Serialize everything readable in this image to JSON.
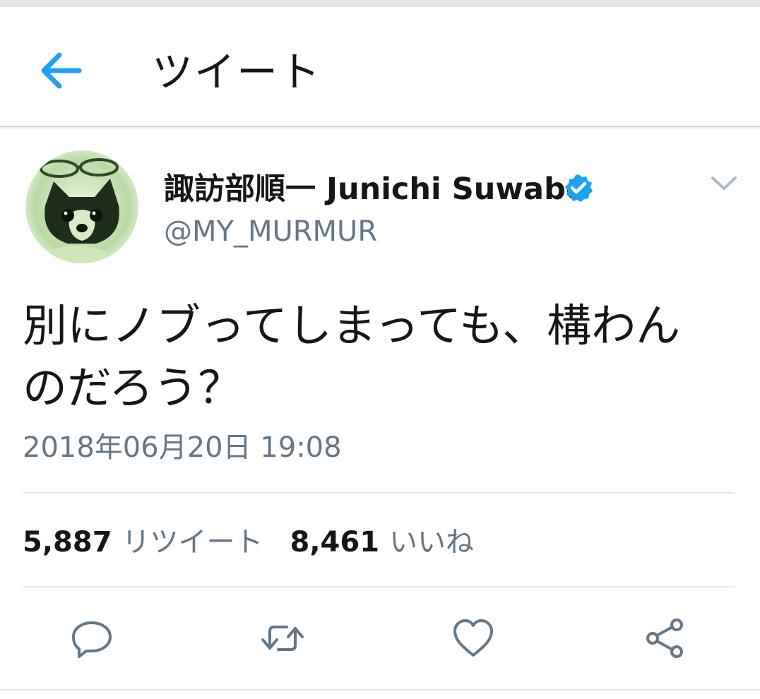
{
  "header": {
    "title": "ツイート",
    "back_icon": "arrow-left-icon",
    "accent_color": "#1da1f2"
  },
  "tweet": {
    "author": {
      "display_name": "諏訪部順一 Junichi Suwabe",
      "handle": "@MY_MURMUR",
      "verified_icon": "verified-badge-icon"
    },
    "menu_icon": "chevron-down-icon",
    "text": "別にノブってしまっても、構わん\nのだろう？",
    "timestamp": "2018年06月20日 19:08",
    "stats": {
      "retweet_count": "5,887",
      "retweet_label": "リツイート",
      "like_count": "8,461",
      "like_label": "いいね"
    },
    "actions": [
      "reply-icon",
      "retweet-icon",
      "like-icon",
      "share-icon"
    ]
  }
}
